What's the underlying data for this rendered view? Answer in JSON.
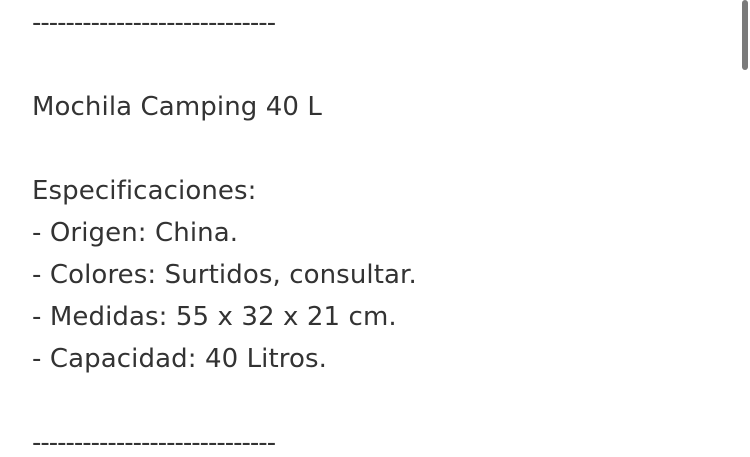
{
  "description": {
    "top_divider": "-----------------------------",
    "title": "Mochila Camping 40 L",
    "specs_heading": "Especificaciones:",
    "specs": [
      "- Origen: China.",
      "- Colores: Surtidos, consultar.",
      "- Medidas: 55 x 32 x 21 cm.",
      "- Capacidad: 40 Litros."
    ],
    "bottom_divider": "-----------------------------"
  },
  "scrollbar": {
    "position": 0.0
  },
  "colors": {
    "text": "#333333",
    "background": "#ffffff",
    "scrollbar_thumb": "#7a7a7a"
  }
}
